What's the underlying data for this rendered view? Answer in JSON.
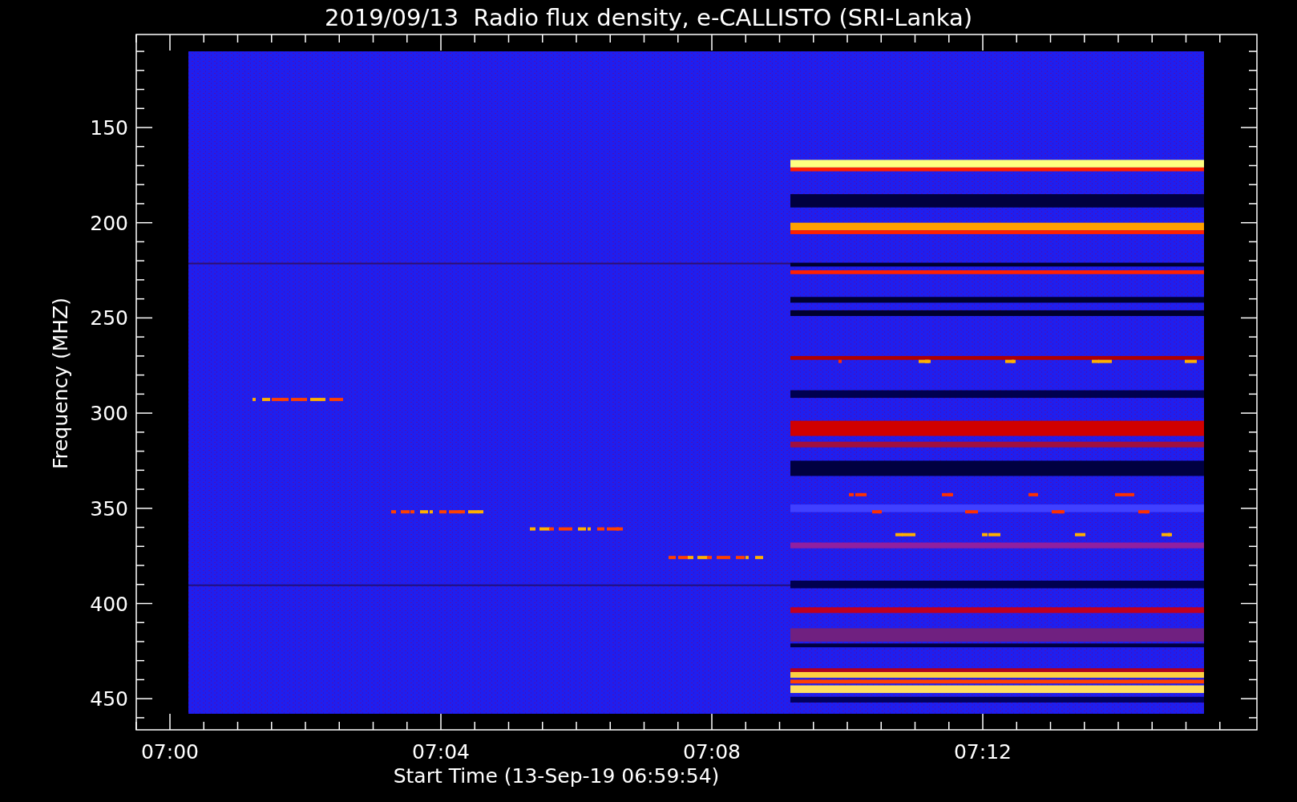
{
  "title": "2019/09/13  Radio flux density, e-CALLISTO (SRI-Lanka)",
  "y_axis": {
    "label": "Frequency (MHZ)",
    "ticks": [
      "150",
      "200",
      "250",
      "300",
      "350",
      "400",
      "450"
    ]
  },
  "x_axis": {
    "label": "Start Time (13-Sep-19 06:59:54)",
    "ticks": [
      "07:00",
      "07:04",
      "07:08",
      "07:12"
    ]
  }
}
